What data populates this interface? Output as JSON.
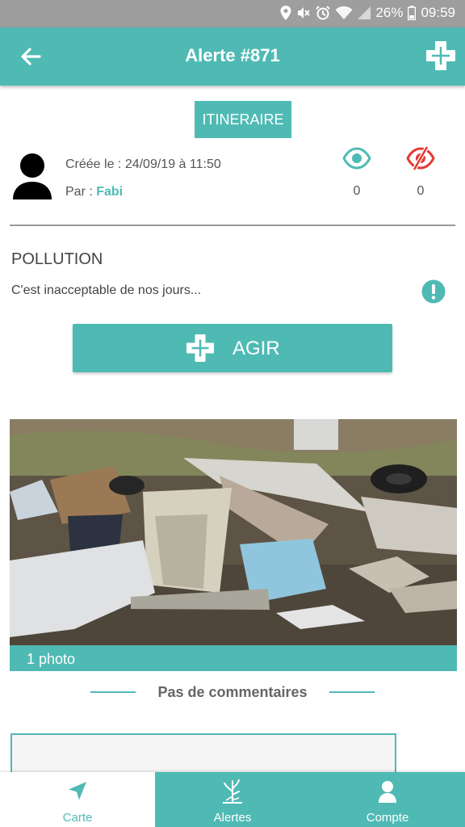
{
  "status_bar": {
    "battery": "26%",
    "time": "09:59",
    "icons": [
      "location-icon",
      "mute-icon",
      "alarm-icon",
      "wifi-icon",
      "signal-icon",
      "battery-icon"
    ]
  },
  "app_bar": {
    "title": "Alerte #871",
    "back_icon": "arrow-left-icon",
    "action_icon": "plus-icon"
  },
  "alert": {
    "itinerary_label": "ITINERAIRE",
    "created": "Créée le : 24/09/19 à 11:50",
    "by_prefix": "Par : ",
    "author": "Fabi",
    "seen_count": "0",
    "unseen_count": "0",
    "category": "POLLUTION",
    "description": "C'est inacceptable de nos jours...",
    "action_label": "AGIR"
  },
  "photo": {
    "caption": "1 photo"
  },
  "comments": {
    "label": "Pas de  commentaires"
  },
  "bottom_nav": {
    "items": [
      {
        "label": "Carte",
        "icon": "navigation-arrow-icon",
        "active": true
      },
      {
        "label": "Alertes",
        "icon": "tree-icon",
        "active": false
      },
      {
        "label": "Compte",
        "icon": "user-icon",
        "active": false
      }
    ]
  },
  "colors": {
    "primary": "#4fbab4",
    "status_bar": "#9e9e9e",
    "unseen": "#e53935"
  }
}
